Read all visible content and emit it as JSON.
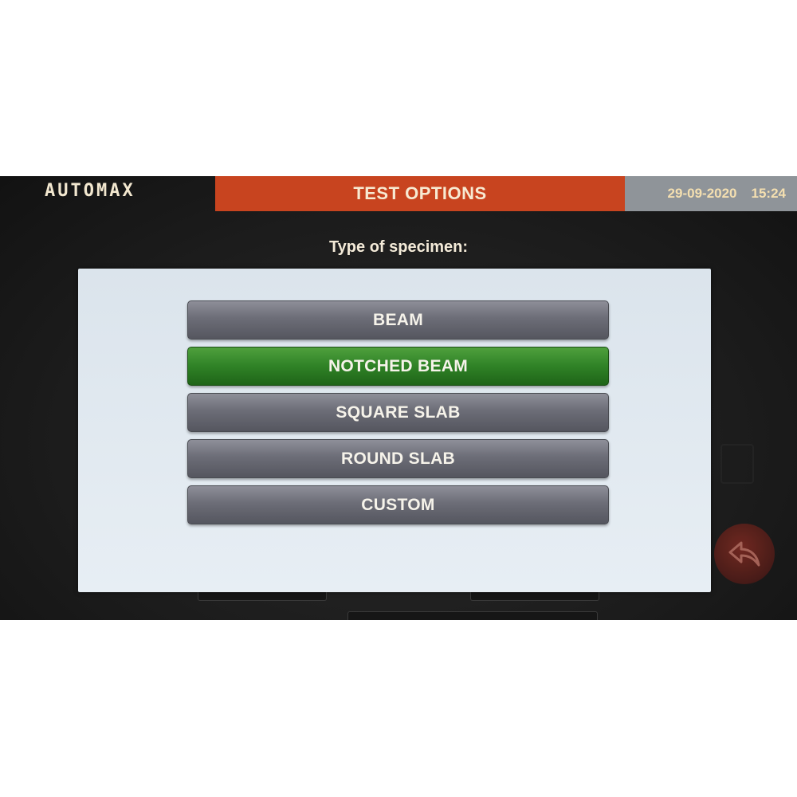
{
  "header": {
    "logo": "AUTOMAX",
    "title": "TEST OPTIONS",
    "date": "29-09-2020",
    "time": "15:24"
  },
  "prompt": "Type of specimen:",
  "options": [
    {
      "label": "BEAM",
      "selected": false
    },
    {
      "label": "NOTCHED BEAM",
      "selected": true
    },
    {
      "label": "SQUARE SLAB",
      "selected": false
    },
    {
      "label": "ROUND SLAB",
      "selected": false
    },
    {
      "label": "CUSTOM",
      "selected": false
    }
  ],
  "colors": {
    "title_bar": "#c8441f",
    "datetime_bar": "#8f9499",
    "selected_option": "#2f8226",
    "option": "#6c6d77"
  },
  "icons": {
    "back": "back-arrow-icon",
    "side": "list-icon"
  }
}
